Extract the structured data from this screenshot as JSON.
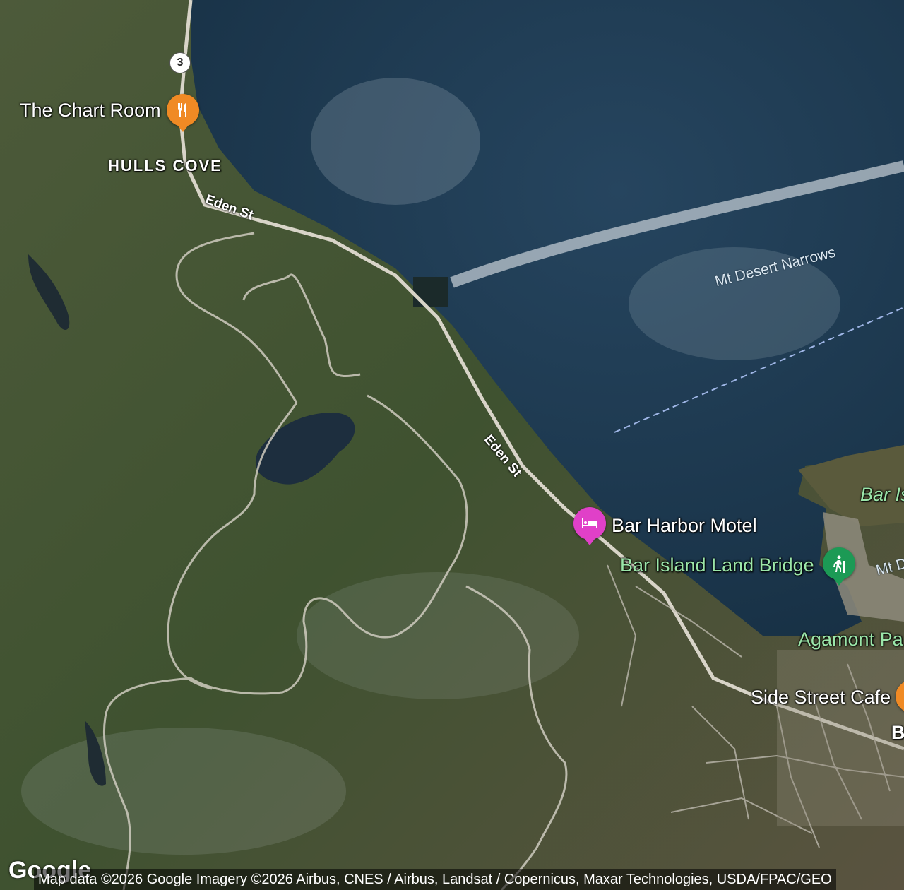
{
  "map": {
    "type": "satellite",
    "colors": {
      "water": "#1f3b52",
      "forest": "#3b4d2e",
      "road": "#d8d4c8",
      "park_label": "#9be6a9",
      "pin_food": "#f08a24",
      "pin_lodging": "#e040c8",
      "pin_park": "#1c9a55"
    }
  },
  "places": {
    "chart_room": "The Chart Room",
    "hulls_cove": "HULLS COVE",
    "bar_harbor_motel": "Bar Harbor Motel",
    "bar_island_land_bridge": "Bar Island Land Bridge",
    "side_street_cafe": "Side Street Cafe",
    "agamont_park": "Agamont Pa",
    "bar_island": "Bar Is",
    "mt_d": "Mt D",
    "b_town": "B"
  },
  "water": {
    "narrows": "Mt Desert Narrows"
  },
  "roads": {
    "eden_st_1": "Eden St",
    "eden_st_2": "Eden St",
    "route_shield": "3"
  },
  "pins": {
    "restaurant_icon": "restaurant-icon",
    "hotel_icon": "hotel-icon",
    "hiking_icon": "hiking-icon"
  },
  "footer": {
    "logo": "Google",
    "attribution": "Map data ©2026 Google Imagery ©2026 Airbus, CNES / Airbus, Landsat / Copernicus, Maxar Technologies, USDA/FPAC/GEO"
  }
}
